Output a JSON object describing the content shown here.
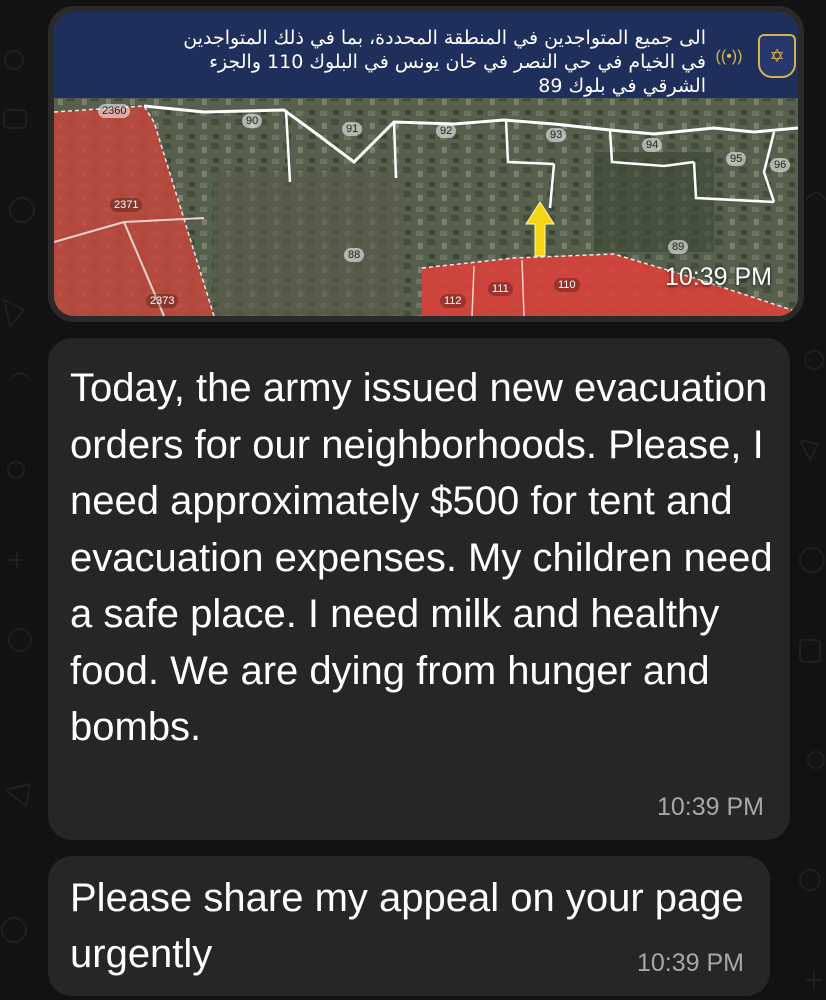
{
  "image_message": {
    "alert_text": "الى جميع المتواجدين في المنطقة المحددة، بما في ذلك المتواجدين\nفي الخيام في حي النصر في خان يونس في البلوك 110 والجزء\nالشرقي في بلوك 89",
    "timestamp": "10:39 PM",
    "logo_icon": "idf-emblem-icon",
    "radio_icon": "broadcast-icon",
    "colors": {
      "header": "#1f2f5c",
      "evacuation_zone": "#d9413a",
      "arrow": "#f5d614"
    },
    "map_blocks": [
      "2360",
      "90",
      "91",
      "92",
      "93",
      "94",
      "95",
      "96",
      "2371",
      "88",
      "89",
      "2373",
      "112",
      "111",
      "110"
    ]
  },
  "messages": [
    {
      "text": "Today, the army issued new evacuation orders for our neighborhoods. Please, I need approximately $500 for tent and evacuation expenses. My children need a safe place. I need milk and healthy food. We are dying from hunger and bombs.",
      "timestamp": "10:39 PM"
    },
    {
      "text": "Please share my appeal on your page urgently",
      "timestamp": "10:39 PM"
    }
  ]
}
